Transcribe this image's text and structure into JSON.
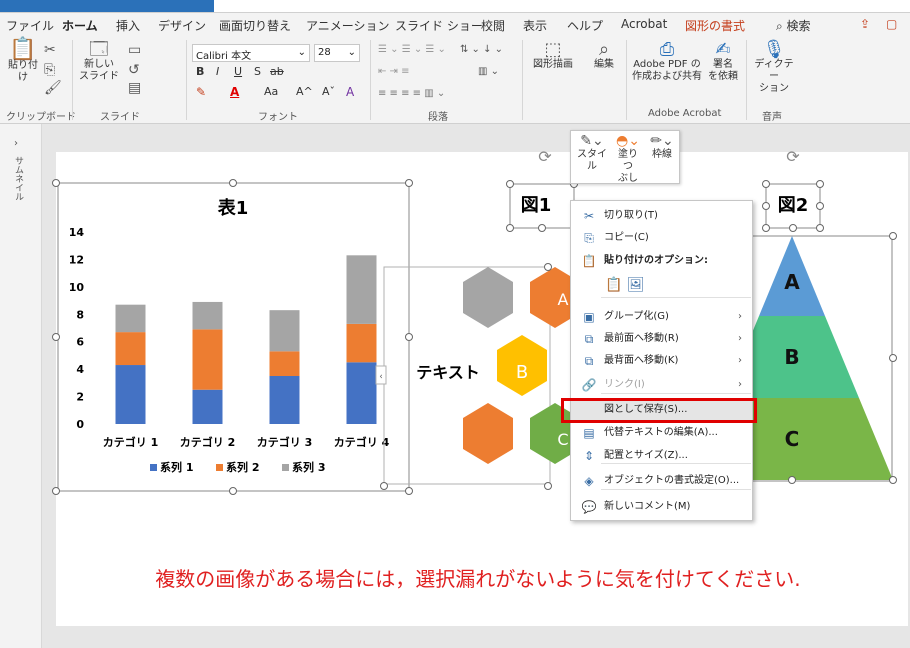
{
  "tabs": [
    {
      "label": "ファイル",
      "x": 6
    },
    {
      "label": "ホーム",
      "x": 62,
      "active": true
    },
    {
      "label": "挿入",
      "x": 116
    },
    {
      "label": "デザイン",
      "x": 158
    },
    {
      "label": "画面切り替え",
      "x": 219
    },
    {
      "label": "アニメーション",
      "x": 306
    },
    {
      "label": "スライド ショー",
      "x": 395
    },
    {
      "label": "校閲",
      "x": 481
    },
    {
      "label": "表示",
      "x": 523
    },
    {
      "label": "ヘルプ",
      "x": 567
    },
    {
      "label": "Acrobat",
      "x": 621
    },
    {
      "label": "図形の書式",
      "x": 685,
      "red": true
    }
  ],
  "search_label": "検索",
  "ribbon": {
    "paste": "貼り付け",
    "new_slide_1": "新しい",
    "new_slide_2": "スライド",
    "font_name": "Calibri 本文",
    "font_size": "28",
    "draw_shape": "図形描画",
    "edit": "編集",
    "adobe_pdf_1": "Adobe PDF の",
    "adobe_pdf_2": "作成および共有",
    "sign_1": "署名",
    "sign_2": "を依頼",
    "dictate_1": "ディクテー",
    "dictate_2": "ション",
    "groups": {
      "clipboard": "クリップボード",
      "slide": "スライド",
      "font": "フォント",
      "paragraph": "段落",
      "adobe": "Adobe Acrobat",
      "voice": "音声"
    }
  },
  "sidepanel_label": "サムネイル",
  "slide": {
    "table_title": "表1",
    "fig1_label": "図1",
    "fig2_label": "図2",
    "text_label": "テキスト",
    "hex_labels": {
      "a": "A",
      "b": "B",
      "c": "C"
    },
    "pyramid_labels": {
      "a": "A",
      "b": "B",
      "c": "C"
    },
    "caption": "複数の画像がある場合には，選択漏れがないように気を付けてください."
  },
  "colors": {
    "series1": "#4472c4",
    "series2": "#ed7d31",
    "series3": "#a5a5a5",
    "hex_gray": "#a5a5a5",
    "hex_orange": "#ed7d31",
    "hex_yellow": "#ffc000",
    "hex_green": "#70ad47",
    "pyr_blue": "#5b9bd5",
    "pyr_teal": "#4dc38a",
    "pyr_green": "#7ab648",
    "caption": "#e02020",
    "highlight": "#e00000"
  },
  "chart_data": {
    "type": "bar",
    "stacked": true,
    "title": "表1",
    "categories": [
      "カテゴリ 1",
      "カテゴリ 2",
      "カテゴリ 3",
      "カテゴリ 4"
    ],
    "series": [
      {
        "name": "系列 1",
        "values": [
          4.3,
          2.5,
          3.5,
          4.5
        ]
      },
      {
        "name": "系列 2",
        "values": [
          2.4,
          4.4,
          1.8,
          2.8
        ]
      },
      {
        "name": "系列 3",
        "values": [
          2.0,
          2.0,
          3.0,
          5.0
        ]
      }
    ],
    "ylim": [
      0,
      14
    ],
    "yticks": [
      0,
      2,
      4,
      6,
      8,
      10,
      12,
      14
    ],
    "legend": "bottom"
  },
  "minitoolbar": {
    "style": "スタイル",
    "fill_1": "塗りつ",
    "fill_2": "ぶし",
    "outline": "枠線"
  },
  "context_menu": {
    "items": [
      {
        "icon": "scissors-icon",
        "glyph": "✂",
        "label": "切り取り(T)"
      },
      {
        "icon": "copy-icon",
        "glyph": "⎘",
        "label": "コピー(C)"
      },
      {
        "icon": "paste-options-icon",
        "glyph": "📋",
        "label": "貼り付けのオプション:",
        "bold": true
      },
      {
        "icon": "group-icon",
        "glyph": "▣",
        "label": "グループ化(G)",
        "arrow": "›"
      },
      {
        "icon": "bring-front-icon",
        "glyph": "⧉",
        "label": "最前面へ移動(R)",
        "arrow": "›"
      },
      {
        "icon": "send-back-icon",
        "glyph": "⧉",
        "label": "最背面へ移動(K)",
        "arrow": "›"
      },
      {
        "icon": "link-icon",
        "glyph": "🔗",
        "label": "リンク(I)",
        "arrow": "›",
        "disabled": true
      },
      {
        "icon": "save-as-picture-icon",
        "glyph": "",
        "label": "図として保存(S)...",
        "highlight": true
      },
      {
        "icon": "alt-text-icon",
        "glyph": "▤",
        "label": "代替テキストの編集(A)..."
      },
      {
        "icon": "size-position-icon",
        "glyph": "⇕",
        "label": "配置とサイズ(Z)..."
      },
      {
        "icon": "format-object-icon",
        "glyph": "◈",
        "label": "オブジェクトの書式設定(O)..."
      },
      {
        "icon": "new-comment-icon",
        "glyph": "💬",
        "label": "新しいコメント(M)"
      }
    ]
  }
}
